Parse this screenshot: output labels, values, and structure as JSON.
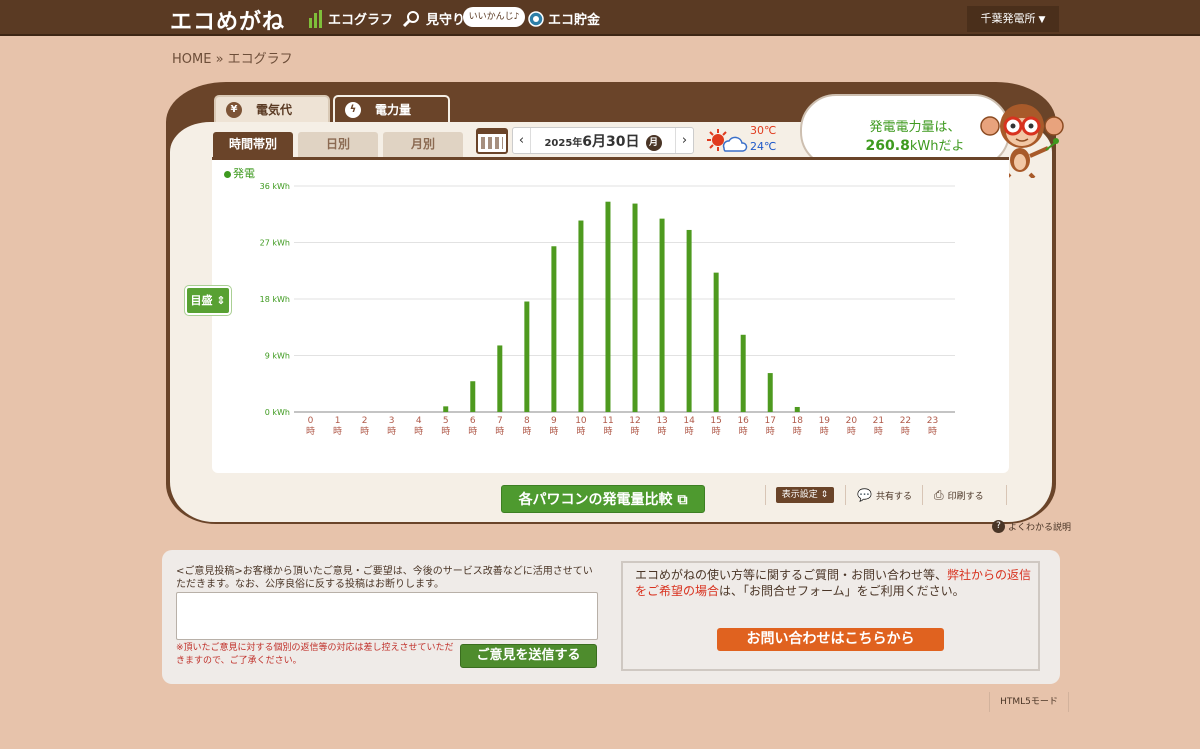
{
  "header": {
    "logo": "エコめがね",
    "nav": [
      {
        "label": "エコグラフ",
        "icon": "bar-chart-icon"
      },
      {
        "label": "見守り",
        "icon": "magnifier-icon"
      },
      {
        "label": "エコ貯金",
        "icon": "coin-icon"
      }
    ],
    "badge": "いいかんじ♪",
    "plant_menu": "千葉発電所"
  },
  "breadcrumb": "HOME » エコグラフ",
  "type_tabs": [
    {
      "label": "電気代",
      "icon": "yen-icon"
    },
    {
      "label": "電力量",
      "icon": "lightning-icon",
      "active": true
    }
  ],
  "period_tabs": [
    {
      "label": "時間帯別",
      "active": true
    },
    {
      "label": "日別"
    },
    {
      "label": "月別"
    }
  ],
  "date": {
    "year_prefix": "2025年",
    "main": "6月30日",
    "weekday": "月",
    "prev": "‹",
    "next": "›"
  },
  "weather": {
    "high": "30℃",
    "low": "24℃",
    "icon": "sun-cloud-icon"
  },
  "bubble": {
    "line1": "発電電力量は、",
    "value": "260.8",
    "unit_suffix": "kWhだよ"
  },
  "scale_button": "目盛 ⇕",
  "chart_data": {
    "type": "bar",
    "series": [
      {
        "name": "発電",
        "color": "#4e9a1f",
        "values": [
          0,
          0,
          0,
          0,
          0,
          0.9,
          4.9,
          10.6,
          17.6,
          26.4,
          30.5,
          33.5,
          33.2,
          30.8,
          29.0,
          22.2,
          12.3,
          6.2,
          0.8,
          0,
          0,
          0,
          0,
          0
        ]
      }
    ],
    "categories": [
      "0",
      "1",
      "2",
      "3",
      "4",
      "5",
      "6",
      "7",
      "8",
      "9",
      "10",
      "11",
      "12",
      "13",
      "14",
      "15",
      "16",
      "17",
      "18",
      "19",
      "20",
      "21",
      "22",
      "23"
    ],
    "category_suffix": "時",
    "yticks": [
      "0 kWh",
      "9 kWh",
      "18 kWh",
      "27 kWh",
      "36 kWh"
    ],
    "ylim": [
      0,
      36
    ],
    "grid": true,
    "legend": "top-left"
  },
  "actions": {
    "compare": "各パワコンの発電量比較",
    "display_settings": "表示設定",
    "share": "共有する",
    "print": "印刷する",
    "help": "よくわかる説明"
  },
  "feedback": {
    "intro": "<ご意見投稿>お客様から頂いたご意見・ご要望は、今後のサービス改善などに活用させていただきます。なお、公序良俗に反する投稿はお断りします。",
    "note": "※頂いたご意見に対する個別の返信等の対応は差し控えさせていただきますので、ご了承ください。",
    "submit": "ご意見を送信する",
    "placeholder": ""
  },
  "contact": {
    "text_a": "エコめがねの使い方等に関するご質問・お問い合わせ等、",
    "text_red": "弊社からの返信をご希望の場合",
    "text_b": "は、「お問合せフォーム」をご利用ください。",
    "button": "お問い合わせはこちらから"
  },
  "footer": {
    "html5": "HTML5モード"
  }
}
